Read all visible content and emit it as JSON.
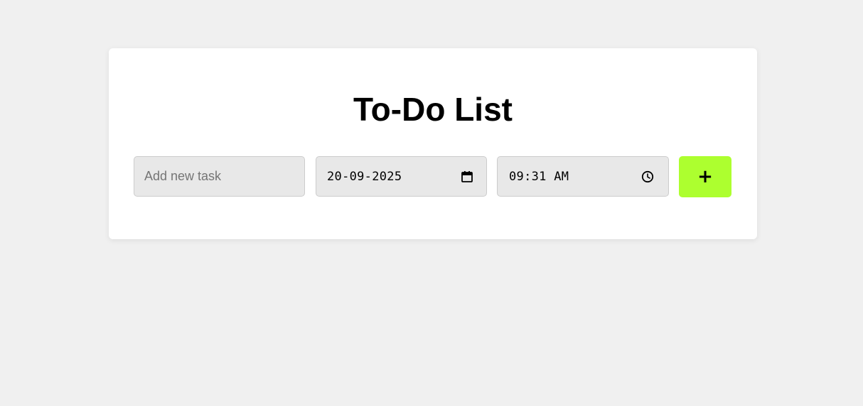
{
  "app": {
    "title": "To-Do List"
  },
  "form": {
    "task_placeholder": "Add new task",
    "task_value": "",
    "date_value": "20-09-2025",
    "time_value": "09:31 AM",
    "add_button_label": "+"
  },
  "icons": {
    "date": "calendar-icon",
    "time": "clock-icon"
  },
  "colors": {
    "background": "#f0f0f0",
    "card": "#ffffff",
    "input_background": "#e8e8e8",
    "accent": "#adff2f"
  }
}
